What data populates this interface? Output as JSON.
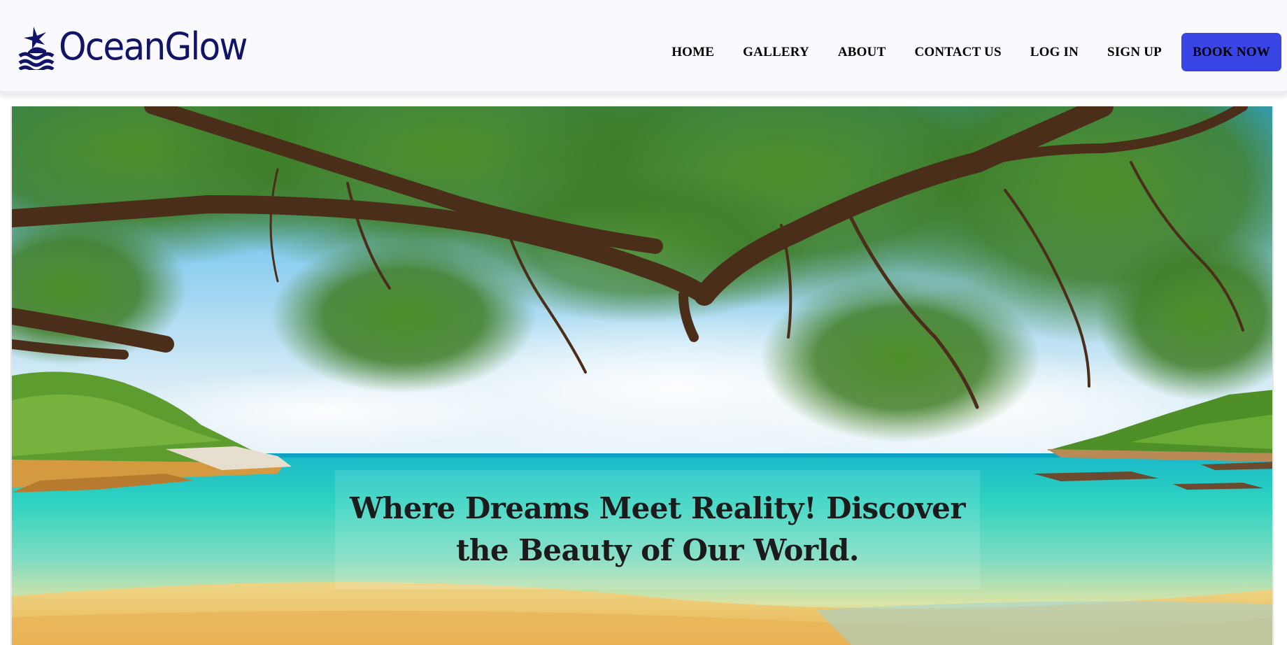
{
  "brand": {
    "name": "OceanGlow",
    "logo_icon": "palm-island-waves-icon",
    "color": "#121468"
  },
  "nav": {
    "items": [
      {
        "label": "HOME"
      },
      {
        "label": "GALLERY"
      },
      {
        "label": "ABOUT"
      },
      {
        "label": "CONTACT US"
      },
      {
        "label": "LOG IN"
      },
      {
        "label": "SIGN UP"
      }
    ],
    "cta": {
      "label": "BOOK NOW",
      "color": "#3a45e6"
    }
  },
  "hero": {
    "tagline": "Where Dreams Meet Reality! Discover the Beauty of Our World."
  }
}
